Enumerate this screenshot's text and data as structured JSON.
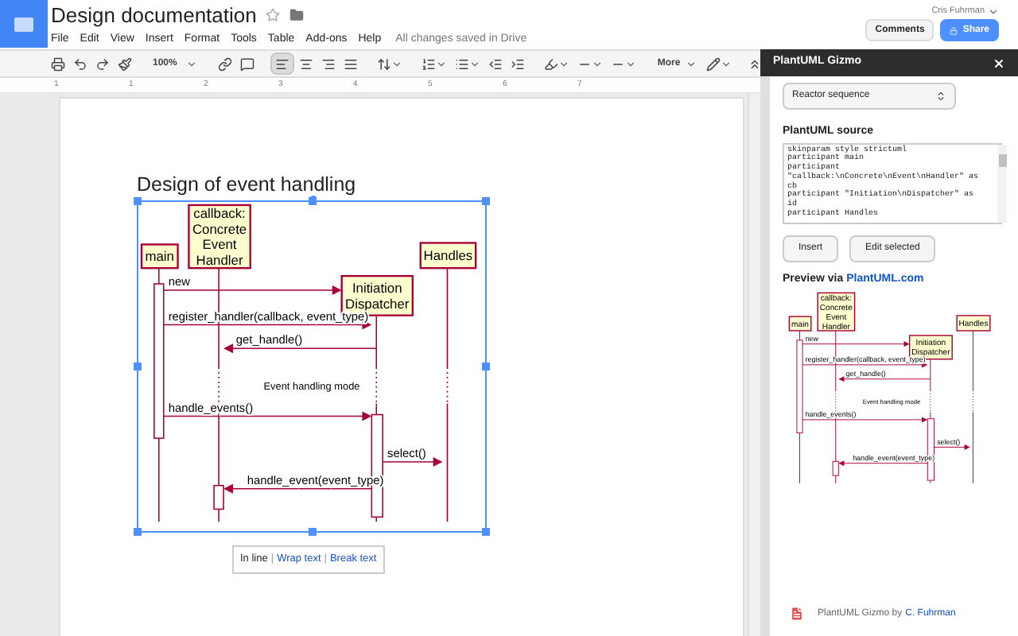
{
  "header": {
    "title": "Design documentation",
    "menus": [
      "File",
      "Edit",
      "View",
      "Insert",
      "Format",
      "Tools",
      "Table",
      "Add-ons",
      "Help"
    ],
    "save_status": "All changes saved in Drive",
    "user": "Cris Fuhrman",
    "comments_button": "Comments",
    "share_button": "Share"
  },
  "toolbar": {
    "zoom": "100%",
    "alignment": [
      {
        "selected": true
      },
      {
        "selected": false
      },
      {
        "selected": false
      },
      {
        "selected": false
      }
    ],
    "more": "More"
  },
  "ruler": [
    "1",
    "1",
    "2",
    "3",
    "4",
    "5",
    "6",
    "7"
  ],
  "document": {
    "heading": "Design of event handling",
    "diagram": {
      "participants": [
        {
          "lines": [
            "main"
          ]
        },
        {
          "lines": [
            "callback:",
            "Concrete",
            "Event",
            "Handler"
          ]
        },
        {
          "lines": [
            "Initiation",
            "Dispatcher"
          ]
        },
        {
          "lines": [
            "Handles"
          ]
        }
      ],
      "messages": [
        "new",
        "register_handler(callback, event_type)",
        "get_handle()",
        "handle_events()",
        "select()",
        "handle_event(event_type)"
      ],
      "divider": "Event handling mode"
    },
    "image_options": [
      {
        "kind": "option",
        "label": "In line",
        "selected": true
      },
      {
        "kind": "separator",
        "label": "|"
      },
      {
        "kind": "option",
        "label": "Wrap text",
        "selected": false
      },
      {
        "kind": "separator",
        "label": "|"
      },
      {
        "kind": "option",
        "label": "Break text",
        "selected": false
      }
    ]
  },
  "sidebar": {
    "title": "PlantUML Gizmo",
    "template": "Reactor sequence",
    "source_label": "PlantUML source",
    "source": "skinparam style strictuml\nparticipant main\nparticipant \"callback:\\nConcrete\\nEvent\\nHandler\" as cb\nparticipant \"Initiation\\nDispatcher\" as id\nparticipant Handles",
    "buttons": [
      "Insert",
      "Edit selected"
    ],
    "preview_label": "Preview via",
    "preview_link": "PlantUML.com",
    "preview_diagram": {
      "participants": [
        {
          "lines": [
            "main"
          ]
        },
        {
          "lines": [
            "callback:",
            "Concrete",
            "Event",
            "Handler"
          ]
        },
        {
          "lines": [
            "Initiation",
            "Dispatcher"
          ]
        },
        {
          "lines": [
            "Handles"
          ]
        }
      ],
      "messages": [
        "new",
        "register_handler(callback, event_type)",
        "get_handle()",
        "handle_events()",
        "select()",
        "handle_event(event_type)"
      ],
      "divider": "Event handling mode"
    },
    "footer_text": "PlantUML Gizmo by",
    "footer_link": "C. Fuhrman"
  }
}
